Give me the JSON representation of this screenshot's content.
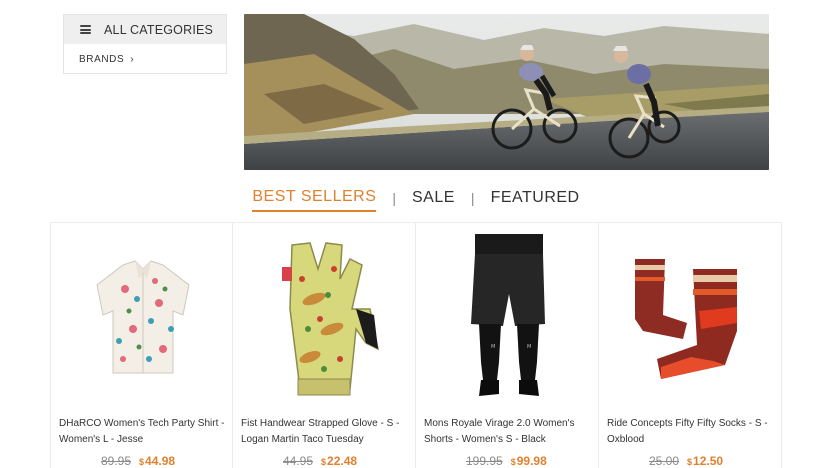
{
  "sidebar": {
    "all_categories": "ALL CATEGORIES",
    "brands": "BRANDS",
    "brands_chevron": "›"
  },
  "banner": {
    "alt_icon": "cyclists-banner-image"
  },
  "tabs": [
    {
      "label": "BEST SELLERS",
      "active": true
    },
    {
      "label": "SALE",
      "active": false
    },
    {
      "label": "FEATURED",
      "active": false
    }
  ],
  "tab_separator": "|",
  "currency": "$",
  "products": [
    {
      "name": "DHaRCO Women's Tech Party Shirt - Women's L - Jesse",
      "old_price": "89.95",
      "price": "44.98",
      "icon": "shirt-product-image"
    },
    {
      "name": "Fist Handwear Strapped Glove - S - Logan Martin Taco Tuesday",
      "old_price": "44.95",
      "price": "22.48",
      "icon": "glove-product-image"
    },
    {
      "name": "Mons Royale Virage 2.0 Women's Shorts - Women's S - Black",
      "old_price": "199.95",
      "price": "99.98",
      "icon": "shorts-product-image"
    },
    {
      "name": "Ride Concepts Fifty Fifty Socks - S - Oxblood",
      "old_price": "25.00",
      "price": "12.50",
      "icon": "socks-product-image"
    }
  ],
  "colors": {
    "accent": "#e0812e"
  }
}
